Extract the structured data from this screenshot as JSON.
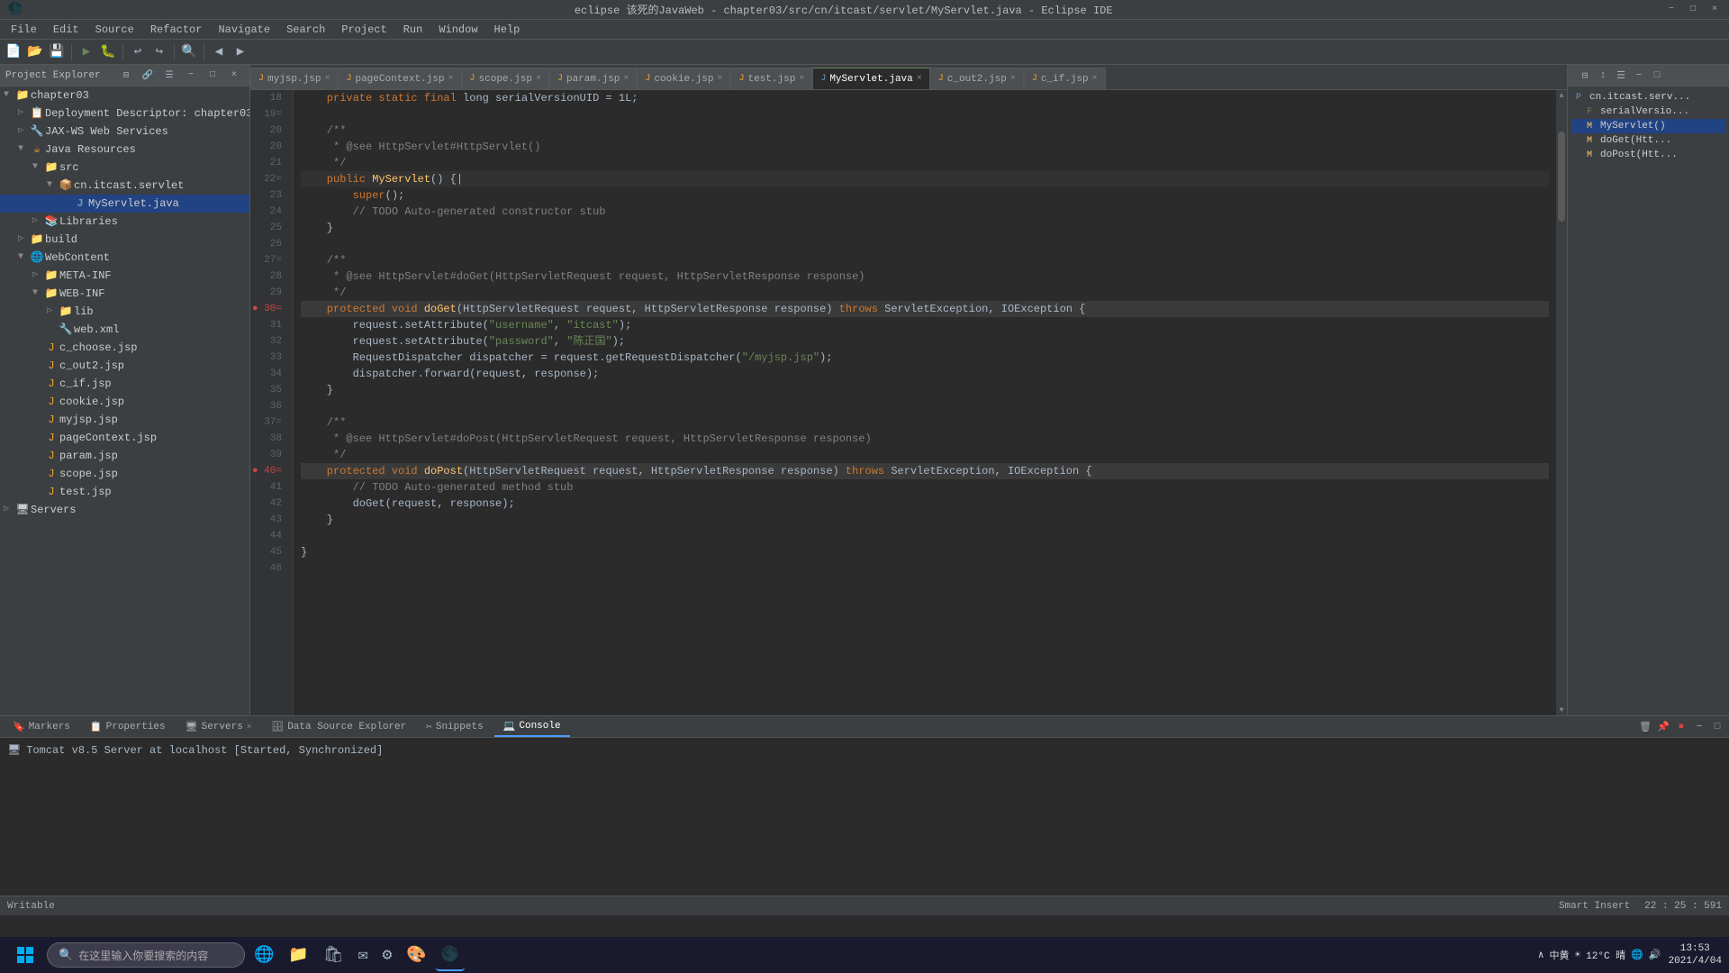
{
  "window": {
    "title": "eclipse 该死的JavaWeb - chapter03/src/cn/itcast/servlet/MyServlet.java - Eclipse IDE",
    "minimize_label": "−",
    "maximize_label": "□",
    "close_label": "×"
  },
  "menu": {
    "items": [
      "File",
      "Edit",
      "Source",
      "Refactor",
      "Navigate",
      "Search",
      "Project",
      "Run",
      "Window",
      "Help"
    ]
  },
  "tabs": [
    {
      "label": "myjsp.jsp",
      "active": false,
      "icon": "J"
    },
    {
      "label": "pageContext.jsp",
      "active": false,
      "icon": "J"
    },
    {
      "label": "scope.jsp",
      "active": false,
      "icon": "J"
    },
    {
      "label": "param.jsp",
      "active": false,
      "icon": "J"
    },
    {
      "label": "cookie.jsp",
      "active": false,
      "icon": "J"
    },
    {
      "label": "test.jsp",
      "active": false,
      "icon": "J"
    },
    {
      "label": "MyServlet.java",
      "active": true,
      "icon": "J"
    },
    {
      "label": "c_out2.jsp",
      "active": false,
      "icon": "J"
    },
    {
      "label": "c_if.jsp",
      "active": false,
      "icon": "J"
    }
  ],
  "project_explorer": {
    "header": "Project Explorer",
    "tree": [
      {
        "label": "chapter03",
        "level": 0,
        "expanded": true,
        "icon": "📁"
      },
      {
        "label": "Deployment Descriptor: chapter03",
        "level": 1,
        "icon": "📋"
      },
      {
        "label": "JAX-WS Web Services",
        "level": 1,
        "icon": "🔧"
      },
      {
        "label": "Java Resources",
        "level": 1,
        "expanded": true,
        "icon": "☕"
      },
      {
        "label": "src",
        "level": 2,
        "expanded": true,
        "icon": "📁"
      },
      {
        "label": "cn.itcast.servlet",
        "level": 3,
        "expanded": true,
        "icon": "📦"
      },
      {
        "label": "MyServlet.java",
        "level": 4,
        "icon": "J",
        "selected": true
      },
      {
        "label": "Libraries",
        "level": 2,
        "icon": "📚"
      },
      {
        "label": "build",
        "level": 1,
        "icon": "📁"
      },
      {
        "label": "WebContent",
        "level": 1,
        "expanded": true,
        "icon": "🌐"
      },
      {
        "label": "META-INF",
        "level": 2,
        "icon": "📁"
      },
      {
        "label": "WEB-INF",
        "level": 2,
        "expanded": true,
        "icon": "📁"
      },
      {
        "label": "lib",
        "level": 3,
        "icon": "📁"
      },
      {
        "label": "web.xml",
        "level": 3,
        "icon": "🔧"
      },
      {
        "label": "c_choose.jsp",
        "level": 2,
        "icon": "J"
      },
      {
        "label": "c_out2.jsp",
        "level": 2,
        "icon": "J"
      },
      {
        "label": "c_if.jsp",
        "level": 2,
        "icon": "J"
      },
      {
        "label": "cookie.jsp",
        "level": 2,
        "icon": "J"
      },
      {
        "label": "myjsp.jsp",
        "level": 2,
        "icon": "J"
      },
      {
        "label": "pageContext.jsp",
        "level": 2,
        "icon": "J"
      },
      {
        "label": "param.jsp",
        "level": 2,
        "icon": "J"
      },
      {
        "label": "scope.jsp",
        "level": 2,
        "icon": "J"
      },
      {
        "label": "test.jsp",
        "level": 2,
        "icon": "J"
      },
      {
        "label": "Servers",
        "level": 0,
        "icon": "🖥"
      }
    ]
  },
  "code": {
    "lines": [
      {
        "num": "18",
        "content": "    private static final long serialVersionUID = 1L;"
      },
      {
        "num": "19=",
        "content": ""
      },
      {
        "num": "20",
        "content": "    /**"
      },
      {
        "num": "20",
        "content": "     * @see HttpServlet#HttpServlet()"
      },
      {
        "num": "21",
        "content": "     */"
      },
      {
        "num": "22=",
        "content": "    public MyServlet() {"
      },
      {
        "num": "23",
        "content": "        super();"
      },
      {
        "num": "24",
        "content": "        // TODO Auto-generated constructor stub"
      },
      {
        "num": "25",
        "content": "    }"
      },
      {
        "num": "26",
        "content": ""
      },
      {
        "num": "27=",
        "content": "    /**"
      },
      {
        "num": "28",
        "content": "     * @see HttpServlet#doGet(HttpServletRequest request, HttpServletResponse response)"
      },
      {
        "num": "29",
        "content": "     */"
      },
      {
        "num": "30=",
        "content": "    protected void doGet(HttpServletRequest request, HttpServletResponse response) throws ServletException, IOException {"
      },
      {
        "num": "31",
        "content": "        request.setAttribute(\"username\", \"itcast\");"
      },
      {
        "num": "32",
        "content": "        request.setAttribute(\"password\", \"陈正国\");"
      },
      {
        "num": "33",
        "content": "        RequestDispatcher dispatcher = request.getRequestDispatcher(\"/myjsp.jsp\");"
      },
      {
        "num": "34",
        "content": "        dispatcher.forward(request, response);"
      },
      {
        "num": "35",
        "content": "    }"
      },
      {
        "num": "36",
        "content": ""
      },
      {
        "num": "37=",
        "content": "    /**"
      },
      {
        "num": "38",
        "content": "     * @see HttpServlet#doPost(HttpServletRequest request, HttpServletResponse response)"
      },
      {
        "num": "39",
        "content": "     */"
      },
      {
        "num": "40=",
        "content": "    protected void doPost(HttpServletRequest request, HttpServletResponse response) throws ServletException, IOException {"
      },
      {
        "num": "41",
        "content": "        // TODO Auto-generated method stub"
      },
      {
        "num": "42",
        "content": "        doGet(request, response);"
      },
      {
        "num": "43",
        "content": "    }"
      },
      {
        "num": "44",
        "content": ""
      },
      {
        "num": "45",
        "content": "}"
      },
      {
        "num": "46",
        "content": ""
      }
    ]
  },
  "outline": {
    "items": [
      {
        "label": "cn.itcast.serv...",
        "level": 0,
        "icon": "P"
      },
      {
        "label": "serialVersio...",
        "level": 1,
        "icon": "F"
      },
      {
        "label": "MyServlet()",
        "level": 1,
        "icon": "M",
        "active": true
      },
      {
        "label": "doGet(Htt...",
        "level": 1,
        "icon": "M"
      },
      {
        "label": "doPost(Htt...",
        "level": 1,
        "icon": "M"
      }
    ]
  },
  "bottom_tabs": [
    "Markers",
    "Properties",
    "Servers",
    "Data Source Explorer",
    "Snippets",
    "Console"
  ],
  "active_bottom_tab": "Console",
  "console": {
    "entry": "Tomcat v8.5 Server at localhost  [Started, Synchronized]"
  },
  "status_bar": {
    "writable": "Writable",
    "insert_mode": "Smart Insert",
    "position": "22 : 25 : 591"
  },
  "taskbar": {
    "search_placeholder": "在这里输入你要搜索的内容",
    "clock_time": "13:53",
    "clock_date": "2021/4/04",
    "weather": "12°C 晴",
    "language": "中黄"
  }
}
